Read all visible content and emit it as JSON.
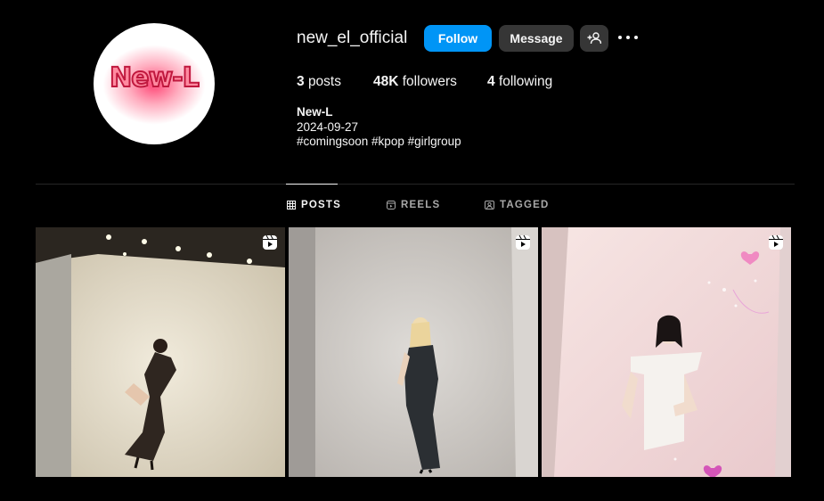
{
  "profile": {
    "username": "new_el_official",
    "avatar_logo_text": "New-L",
    "buttons": {
      "follow": "Follow",
      "message": "Message",
      "add_user_icon": "person-add-icon",
      "more_icon": "more-icon"
    },
    "stats": {
      "posts_count": "3",
      "posts_label": "posts",
      "followers_count": "48K",
      "followers_label": "followers",
      "following_count": "4",
      "following_label": "following"
    },
    "bio": {
      "name": "New-L",
      "line1": "2024-09-27",
      "line2": "#comingsoon #kpop #girlgroup"
    }
  },
  "tabs": [
    {
      "label": "POSTS",
      "icon": "grid-icon",
      "active": true
    },
    {
      "label": "REELS",
      "icon": "reels-icon",
      "active": false
    },
    {
      "label": "TAGGED",
      "icon": "tagged-icon",
      "active": false
    }
  ],
  "posts": [
    {
      "type": "reel",
      "badge_icon": "reels-icon",
      "description_icon": "photo"
    },
    {
      "type": "reel",
      "badge_icon": "reels-icon",
      "description_icon": "photo"
    },
    {
      "type": "reel",
      "badge_icon": "reels-icon",
      "description_icon": "photo"
    }
  ],
  "colors": {
    "background": "#000000",
    "accent_blue": "#0095f6",
    "button_gray": "#363636",
    "text_primary": "#f5f5f5",
    "text_secondary": "#a8a8a8"
  }
}
